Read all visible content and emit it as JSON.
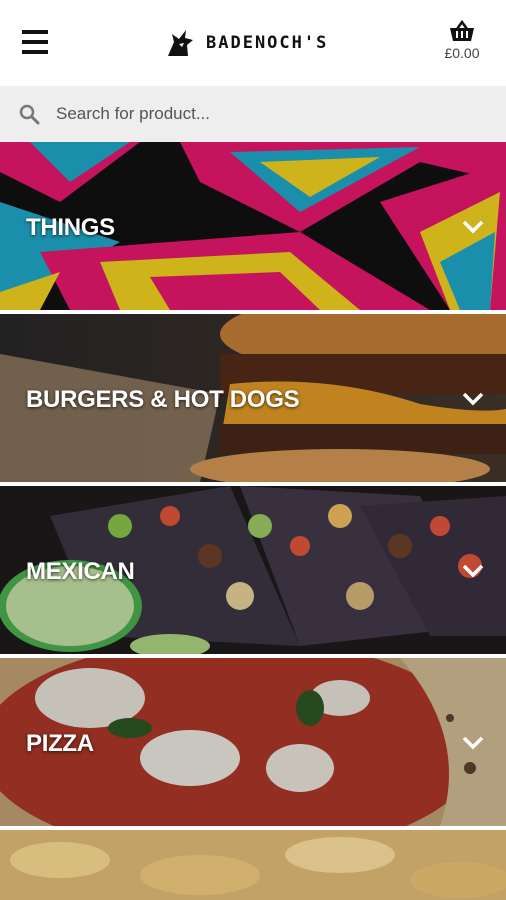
{
  "header": {
    "brand": "BADENOCH'S",
    "basket_total": "£0.00"
  },
  "search": {
    "placeholder": "Search for product..."
  },
  "categories": [
    {
      "label": "THINGS"
    },
    {
      "label": "BURGERS & HOT DOGS"
    },
    {
      "label": "MEXICAN"
    },
    {
      "label": "PIZZA"
    },
    {
      "label": ""
    }
  ],
  "icons": {
    "menu": "hamburger-icon",
    "logo": "wolf-head-icon",
    "basket": "basket-icon",
    "search": "search-icon",
    "expand": "chevron-down-icon"
  }
}
